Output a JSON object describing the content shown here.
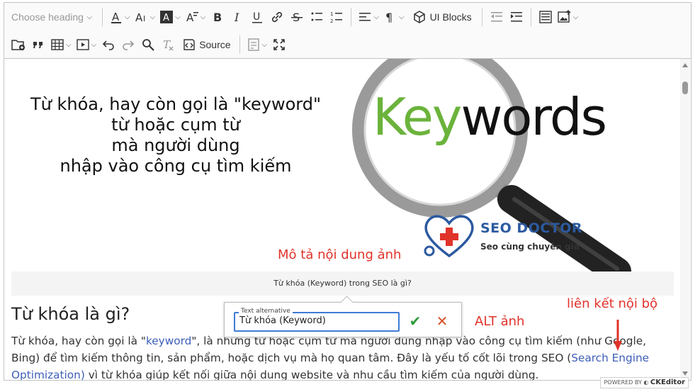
{
  "toolbar": {
    "heading_placeholder": "Choose heading",
    "ui_blocks_label": "UI Blocks",
    "source_label": "Source"
  },
  "image": {
    "text_line1": "Từ khóa, hay còn gọi là \"keyword\"",
    "text_line2": "từ hoặc cụm từ",
    "text_line3": "mà người dùng",
    "text_line4": "nhập vào công cụ tìm kiếm",
    "kw_green": "Key",
    "kw_black": "words",
    "logo_title": "SEO DOCTOR",
    "logo_subtitle": "Seo cùng chuyên gia"
  },
  "annotations": {
    "image_desc": "Mô tả nội dung ảnh",
    "alt": "ALT ảnh",
    "internal_link": "liên kết nội bộ"
  },
  "caption": "Từ khóa (Keyword) trong SEO là gì?",
  "heading": "Từ khóa là gì?",
  "paragraph": {
    "p1": "Từ khóa, hay còn gọi là \"",
    "link1": "keyword",
    "p2": "\", là những từ hoặc cụm từ mà người dùng nhập vào công cụ tìm kiếm (như Google, Bing) để tìm kiếm thông tin, sản phẩm, hoặc dịch vụ mà họ quan tâm. Đây là yếu tố cốt lõi trong SEO (",
    "link2": "Search Engine Optimization)",
    "p3": " vì từ khóa giúp kết nối giữa nội dung website và nhu cầu tìm kiếm của người dùng."
  },
  "alt_balloon": {
    "label": "Text alternative",
    "value": "Từ khóa (Keyword)"
  },
  "powered_by": {
    "prefix": "POWERED BY",
    "brand": "CKEditor"
  },
  "colors": {
    "annotation_red": "#e0332a",
    "link_blue": "#3e5fb8",
    "focus_blue": "#3e7bd6",
    "keyword_green": "#6bb33c"
  }
}
